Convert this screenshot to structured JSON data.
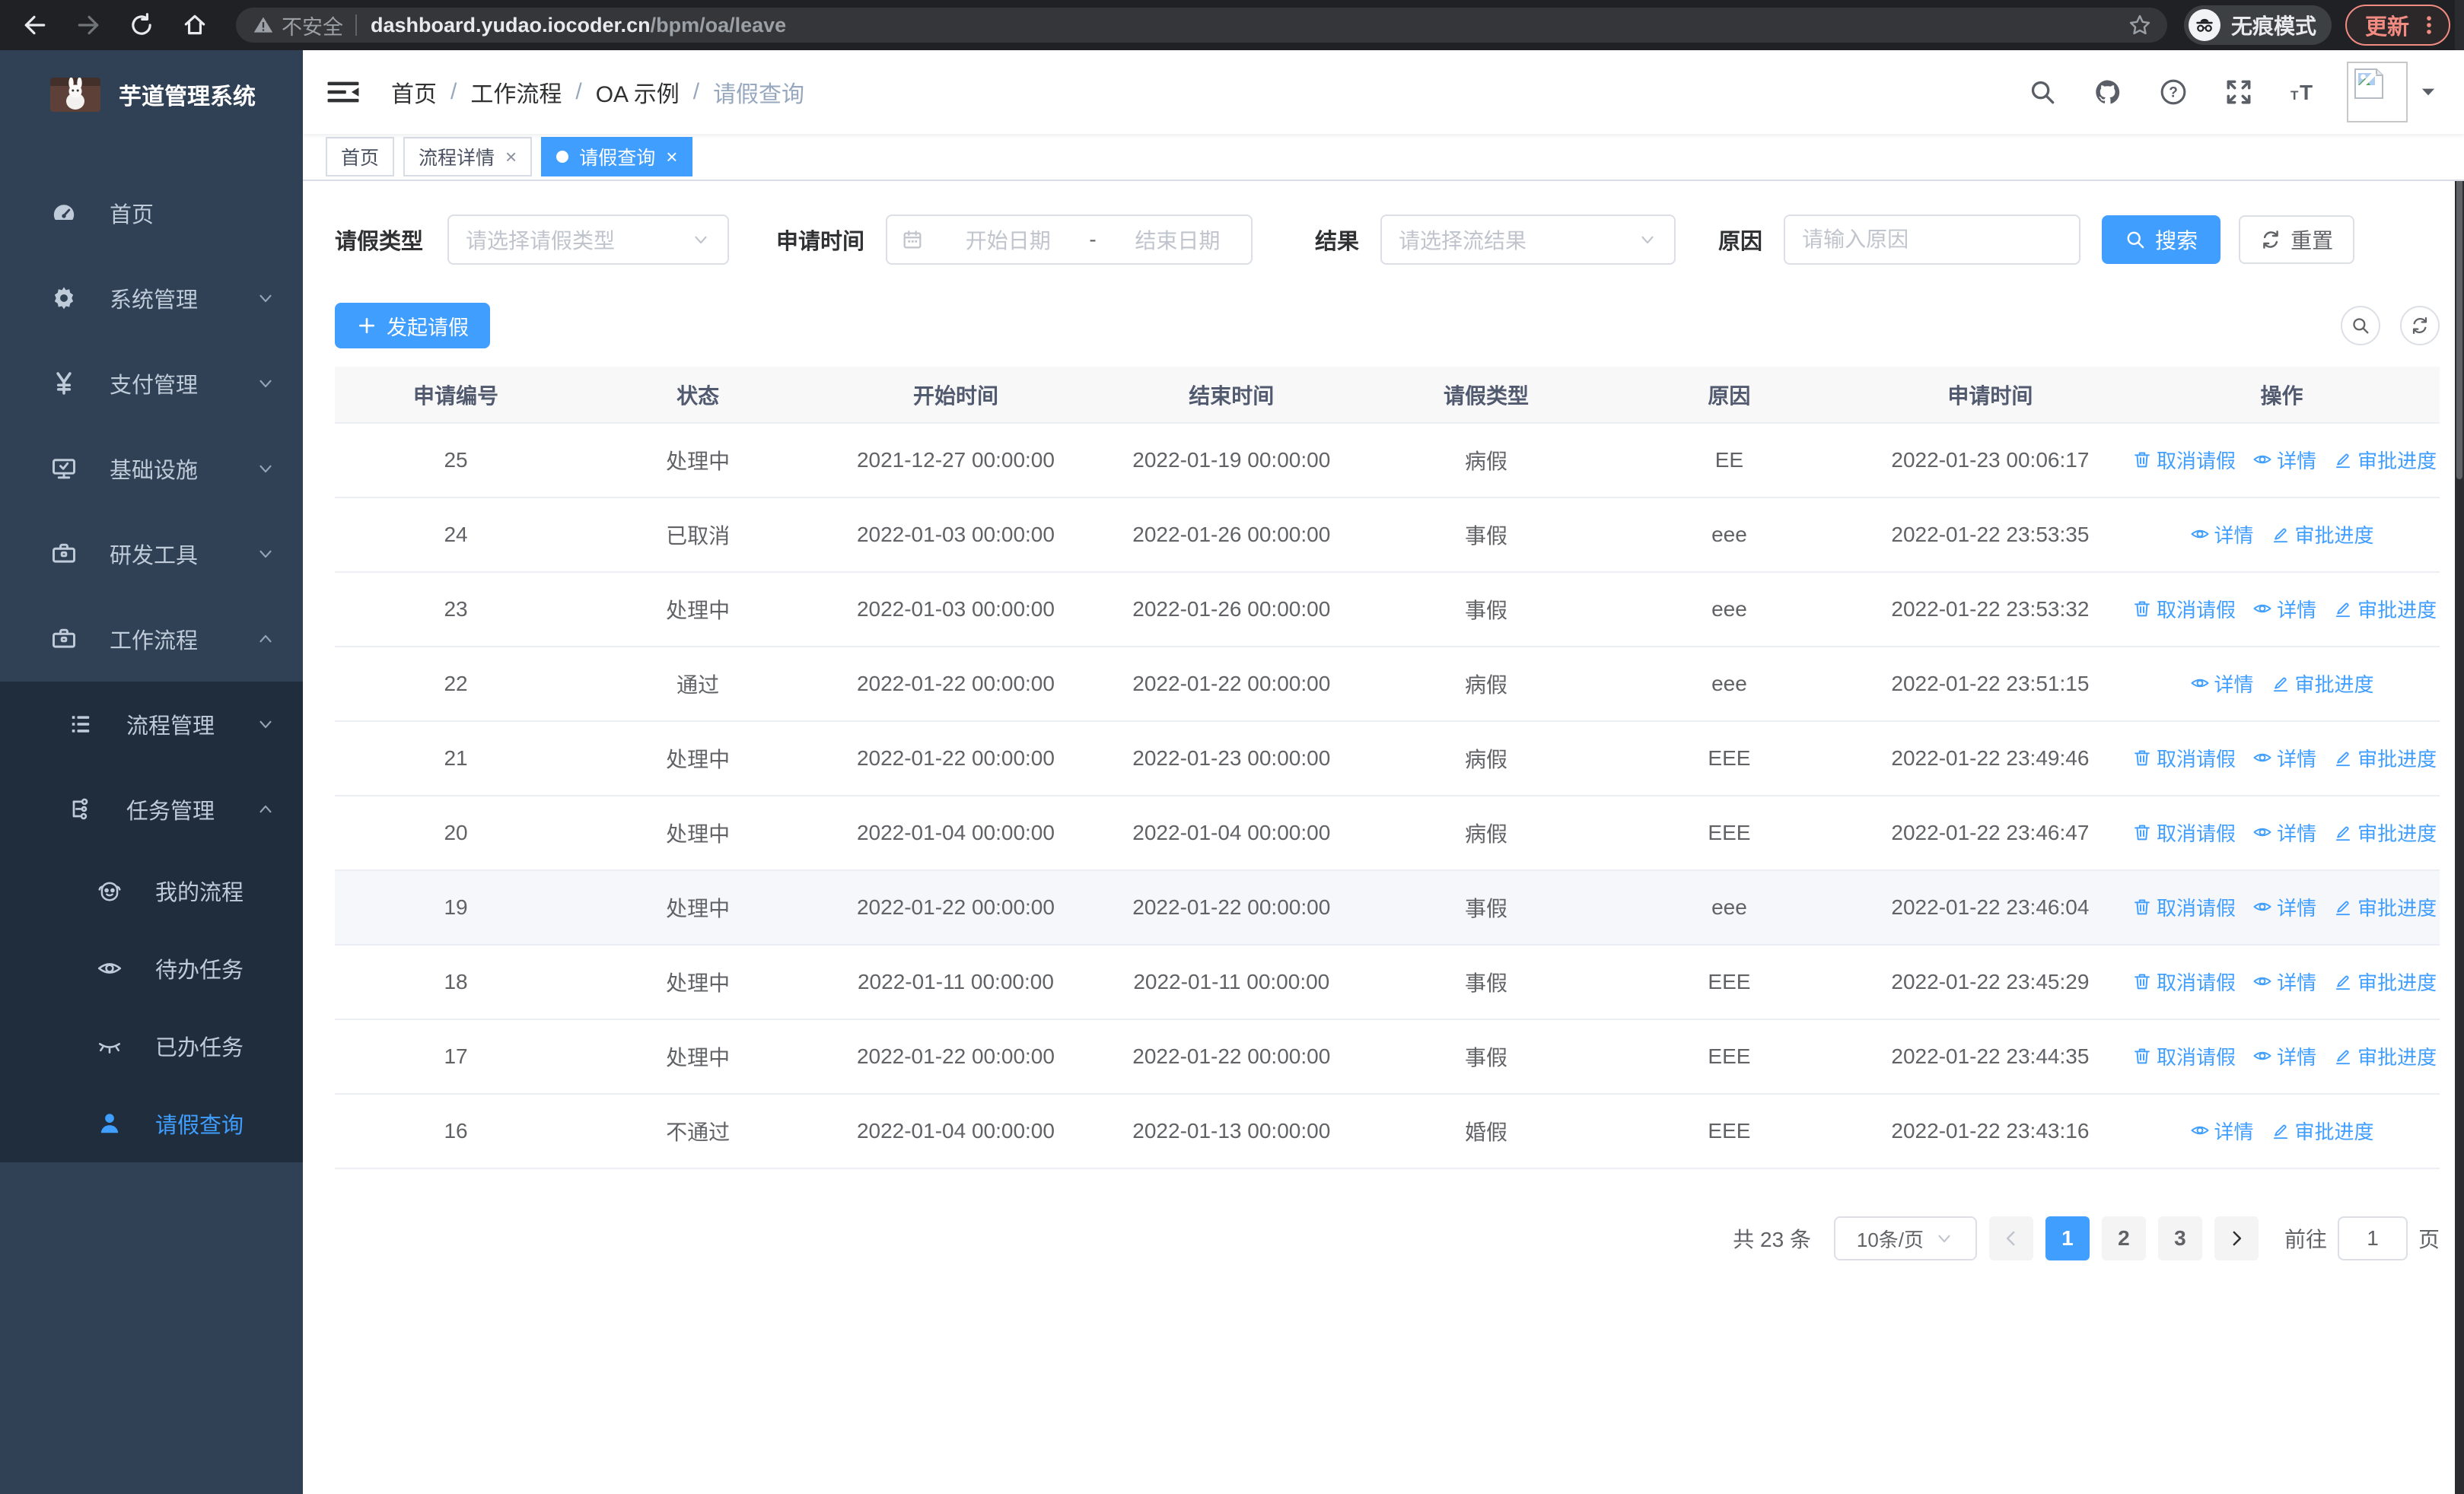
{
  "colors": {
    "accent": "#409eff",
    "sidebar_bg": "#304156",
    "submenu_bg": "#1f2d3d",
    "coral": "#f28b82",
    "table_header_bg": "#f8f8f9"
  },
  "browser": {
    "nav_icons": [
      {
        "icon": "back-icon"
      },
      {
        "icon": "forward-icon",
        "dim": true
      },
      {
        "icon": "reload-icon"
      },
      {
        "icon": "home-icon"
      }
    ],
    "security_label": "不安全",
    "url_host": "dashboard.yudao.iocoder.cn",
    "url_path": "/bpm/oa/leave",
    "incognito_label": "无痕模式",
    "update_label": "更新"
  },
  "sidebar": {
    "title": "芋道管理系统",
    "items": [
      {
        "label": "首页",
        "icon": "dashboard-icon",
        "depth": 0
      },
      {
        "label": "系统管理",
        "icon": "gear-icon",
        "depth": 0,
        "arrow": "down"
      },
      {
        "label": "支付管理",
        "icon": "yen-icon",
        "depth": 0,
        "arrow": "down"
      },
      {
        "label": "基础设施",
        "icon": "monitor-icon",
        "depth": 0,
        "arrow": "down"
      },
      {
        "label": "研发工具",
        "icon": "toolbox-icon",
        "depth": 0,
        "arrow": "down"
      },
      {
        "label": "工作流程",
        "icon": "briefcase-icon",
        "depth": 0,
        "arrow": "up"
      },
      {
        "label": "流程管理",
        "icon": "list-icon",
        "depth": 1,
        "arrow": "down"
      },
      {
        "label": "任务管理",
        "icon": "tree-icon",
        "depth": 1,
        "arrow": "up"
      },
      {
        "label": "我的流程",
        "icon": "robot-icon",
        "depth": 2
      },
      {
        "label": "待办任务",
        "icon": "eye-icon",
        "depth": 2
      },
      {
        "label": "已办任务",
        "icon": "eye-closed-icon",
        "depth": 2
      },
      {
        "label": "请假查询",
        "icon": "user-icon",
        "depth": 2,
        "active": true
      }
    ]
  },
  "header": {
    "breadcrumb": [
      "首页",
      "工作流程",
      "OA 示例",
      "请假查询"
    ],
    "icons": [
      "search-icon",
      "github-icon",
      "help-icon",
      "fullscreen-icon",
      "font-size-icon"
    ]
  },
  "tabs": [
    {
      "label": "首页",
      "closable": false,
      "active": false
    },
    {
      "label": "流程详情",
      "closable": true,
      "active": false
    },
    {
      "label": "请假查询",
      "closable": true,
      "active": true
    }
  ],
  "filters": {
    "leave_type_label": "请假类型",
    "leave_type_placeholder": "请选择请假类型",
    "apply_time_label": "申请时间",
    "start_placeholder": "开始日期",
    "range_separator": "-",
    "end_placeholder": "结束日期",
    "result_label": "结果",
    "result_placeholder": "请选择流结果",
    "reason_label": "原因",
    "reason_placeholder": "请输入原因",
    "search_label": "搜索",
    "reset_label": "重置"
  },
  "toolbar": {
    "create_label": "发起请假"
  },
  "table": {
    "columns": [
      "申请编号",
      "状态",
      "开始时间",
      "结束时间",
      "请假类型",
      "原因",
      "申请时间",
      "操作"
    ],
    "action_labels": {
      "cancel": "取消请假",
      "detail": "详情",
      "progress": "审批进度"
    },
    "rows": [
      {
        "id": "25",
        "status": "处理中",
        "start": "2021-12-27 00:00:00",
        "end": "2022-01-19 00:00:00",
        "type": "病假",
        "reason": "EE",
        "applied": "2022-01-23 00:06:17",
        "actions": [
          "cancel",
          "detail",
          "progress"
        ]
      },
      {
        "id": "24",
        "status": "已取消",
        "start": "2022-01-03 00:00:00",
        "end": "2022-01-26 00:00:00",
        "type": "事假",
        "reason": "eee",
        "applied": "2022-01-22 23:53:35",
        "actions": [
          "detail",
          "progress"
        ]
      },
      {
        "id": "23",
        "status": "处理中",
        "start": "2022-01-03 00:00:00",
        "end": "2022-01-26 00:00:00",
        "type": "事假",
        "reason": "eee",
        "applied": "2022-01-22 23:53:32",
        "actions": [
          "cancel",
          "detail",
          "progress"
        ]
      },
      {
        "id": "22",
        "status": "通过",
        "start": "2022-01-22 00:00:00",
        "end": "2022-01-22 00:00:00",
        "type": "病假",
        "reason": "eee",
        "applied": "2022-01-22 23:51:15",
        "actions": [
          "detail",
          "progress"
        ]
      },
      {
        "id": "21",
        "status": "处理中",
        "start": "2022-01-22 00:00:00",
        "end": "2022-01-23 00:00:00",
        "type": "病假",
        "reason": "EEE",
        "applied": "2022-01-22 23:49:46",
        "actions": [
          "cancel",
          "detail",
          "progress"
        ]
      },
      {
        "id": "20",
        "status": "处理中",
        "start": "2022-01-04 00:00:00",
        "end": "2022-01-04 00:00:00",
        "type": "病假",
        "reason": "EEE",
        "applied": "2022-01-22 23:46:47",
        "actions": [
          "cancel",
          "detail",
          "progress"
        ]
      },
      {
        "id": "19",
        "status": "处理中",
        "start": "2022-01-22 00:00:00",
        "end": "2022-01-22 00:00:00",
        "type": "事假",
        "reason": "eee",
        "applied": "2022-01-22 23:46:04",
        "actions": [
          "cancel",
          "detail",
          "progress"
        ],
        "highlighted": true
      },
      {
        "id": "18",
        "status": "处理中",
        "start": "2022-01-11 00:00:00",
        "end": "2022-01-11 00:00:00",
        "type": "事假",
        "reason": "EEE",
        "applied": "2022-01-22 23:45:29",
        "actions": [
          "cancel",
          "detail",
          "progress"
        ]
      },
      {
        "id": "17",
        "status": "处理中",
        "start": "2022-01-22 00:00:00",
        "end": "2022-01-22 00:00:00",
        "type": "事假",
        "reason": "EEE",
        "applied": "2022-01-22 23:44:35",
        "actions": [
          "cancel",
          "detail",
          "progress"
        ]
      },
      {
        "id": "16",
        "status": "不通过",
        "start": "2022-01-04 00:00:00",
        "end": "2022-01-13 00:00:00",
        "type": "婚假",
        "reason": "EEE",
        "applied": "2022-01-22 23:43:16",
        "actions": [
          "detail",
          "progress"
        ]
      }
    ]
  },
  "pagination": {
    "total_label": "共 23 条",
    "page_size_label": "10条/页",
    "pages": [
      "1",
      "2",
      "3"
    ],
    "active_page": "1",
    "goto_label": "前往",
    "goto_value": "1",
    "page_suffix": "页"
  }
}
